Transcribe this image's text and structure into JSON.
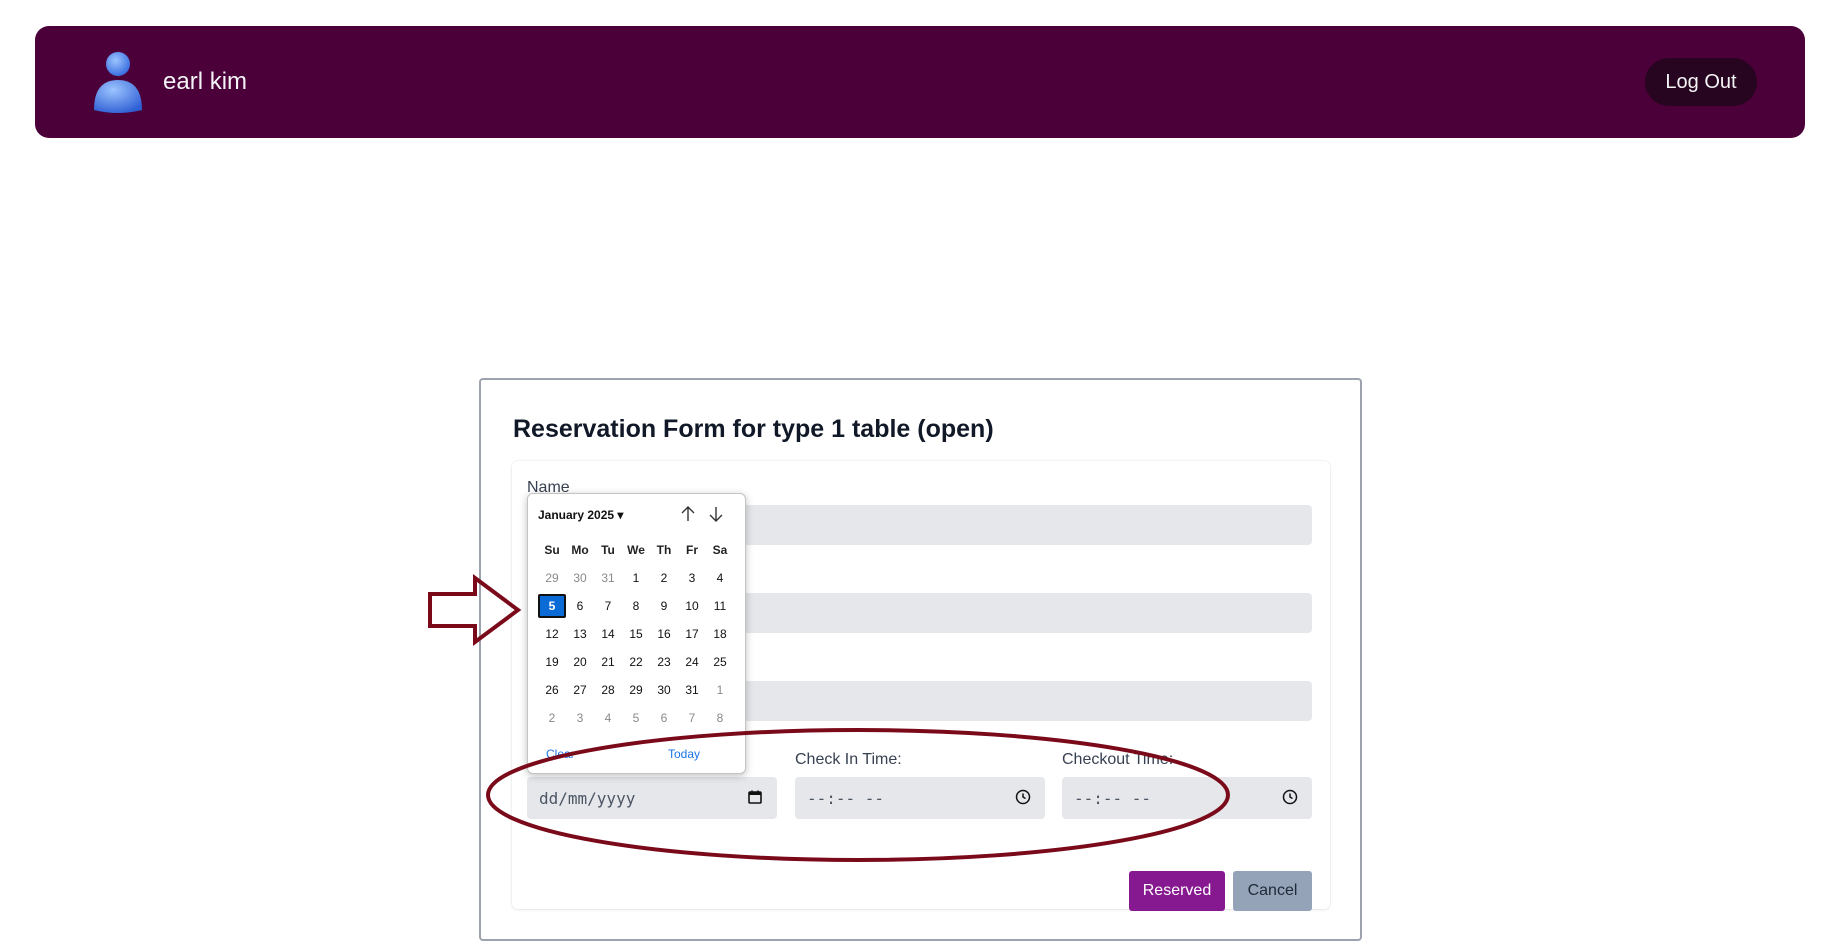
{
  "header": {
    "username": "earl kim",
    "logout_label": "Log Out",
    "background": "#4c003a"
  },
  "form": {
    "title": "Reservation Form for type 1 table (open)",
    "name_label": "Name",
    "date_placeholder": "dd/mm/yyyy",
    "checkin_label": "Check In Time:",
    "checkin_value": "--:-- --",
    "checkout_label": "Checkout Time:",
    "checkout_value": "--:-- --",
    "reserve_label": "Reserved",
    "cancel_label": "Cancel",
    "reserve_color": "#86198f"
  },
  "calendar": {
    "month_label": "January 2025",
    "weekdays": [
      "Su",
      "Mo",
      "Tu",
      "We",
      "Th",
      "Fr",
      "Sa"
    ],
    "weeks": [
      [
        "29",
        "30",
        "31",
        "1",
        "2",
        "3",
        "4"
      ],
      [
        "5",
        "6",
        "7",
        "8",
        "9",
        "10",
        "11"
      ],
      [
        "12",
        "13",
        "14",
        "15",
        "16",
        "17",
        "18"
      ],
      [
        "19",
        "20",
        "21",
        "22",
        "23",
        "24",
        "25"
      ],
      [
        "26",
        "27",
        "28",
        "29",
        "30",
        "31",
        "1"
      ],
      [
        "2",
        "3",
        "4",
        "5",
        "6",
        "7",
        "8"
      ]
    ],
    "selected": "5",
    "clear_label": "Clear",
    "today_label": "Today"
  },
  "icons": {
    "avatar": "user-avatar-icon",
    "calendar": "calendar-icon",
    "clock": "clock-icon",
    "prev": "arrow-up-icon",
    "next": "arrow-down-icon"
  }
}
